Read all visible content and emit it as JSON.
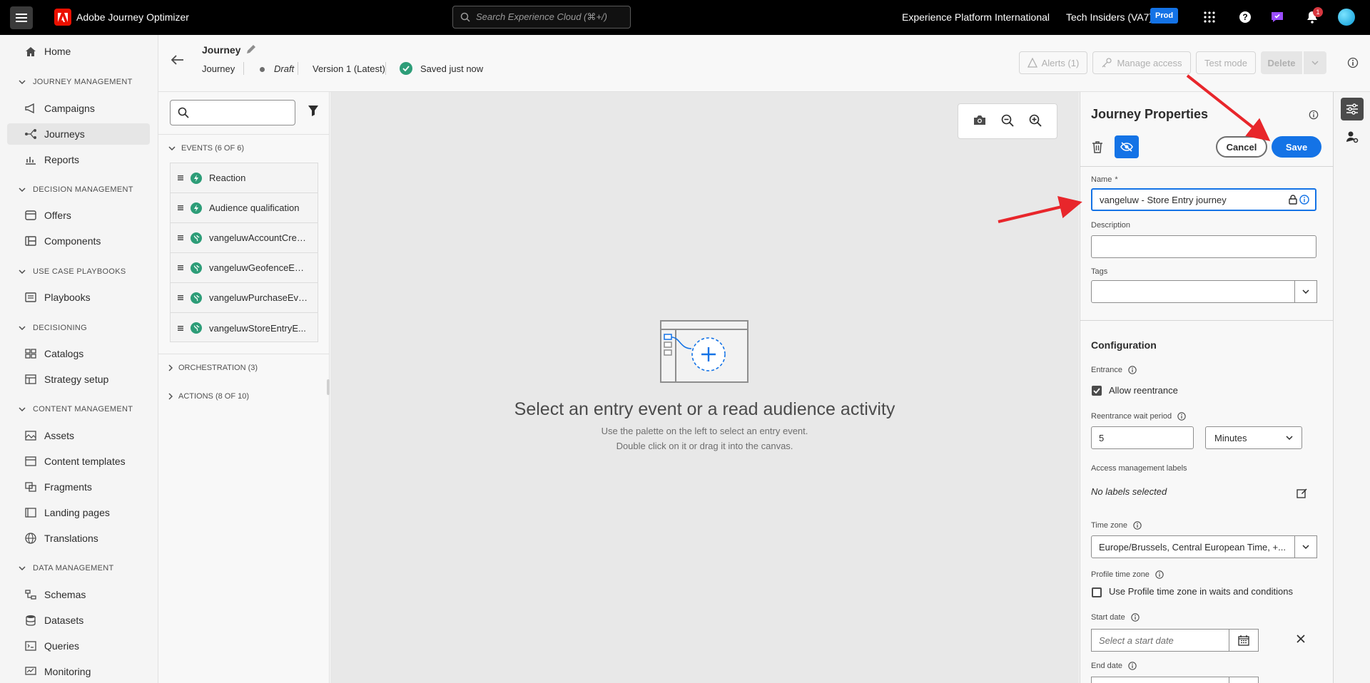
{
  "topbar": {
    "app_title": "Adobe Journey Optimizer",
    "search_placeholder": "Search Experience Cloud (⌘+/)",
    "org": "Experience Platform International",
    "sandbox": "Tech Insiders (VA7)",
    "env_badge": "Prod",
    "notification_count": "1"
  },
  "nav": {
    "home": "Home",
    "sections": {
      "journey_management": "JOURNEY MANAGEMENT",
      "decision_management": "DECISION MANAGEMENT",
      "use_case_playbooks": "USE CASE PLAYBOOKS",
      "decisioning": "DECISIONING",
      "content_management": "CONTENT MANAGEMENT",
      "data_management": "DATA MANAGEMENT"
    },
    "items": {
      "campaigns": "Campaigns",
      "journeys": "Journeys",
      "reports": "Reports",
      "offers": "Offers",
      "components": "Components",
      "playbooks": "Playbooks",
      "catalogs": "Catalogs",
      "strategy_setup": "Strategy setup",
      "assets": "Assets",
      "content_templates": "Content templates",
      "fragments": "Fragments",
      "landing_pages": "Landing pages",
      "translations": "Translations",
      "schemas": "Schemas",
      "datasets": "Datasets",
      "queries": "Queries",
      "monitoring": "Monitoring"
    }
  },
  "header": {
    "journey_name": "Journey",
    "journey_type": "Journey",
    "status": "Draft",
    "version": "Version 1 (Latest)",
    "saved": "Saved just now",
    "alerts": "Alerts (1)",
    "manage_access": "Manage access",
    "test_mode": "Test mode",
    "delete": "Delete"
  },
  "palette": {
    "events_header": "EVENTS (6 OF 6)",
    "events": [
      {
        "label": "Reaction",
        "icon": "lightning-icon"
      },
      {
        "label": "Audience qualification",
        "icon": "lightning-icon"
      },
      {
        "label": "vangeluwAccountCrea...",
        "icon": "globe-icon"
      },
      {
        "label": "vangeluwGeofenceEnt...",
        "icon": "globe-icon"
      },
      {
        "label": "vangeluwPurchaseEvent",
        "icon": "globe-icon"
      },
      {
        "label": "vangeluwStoreEntryE...",
        "icon": "globe-icon"
      }
    ],
    "orchestration_header": "ORCHESTRATION (3)",
    "actions_header": "ACTIONS (8 OF 10)"
  },
  "canvas": {
    "title": "Select an entry event or a read audience activity",
    "sub1": "Use the palette on the left to select an entry event.",
    "sub2": "Double click on it or drag it into the canvas."
  },
  "properties": {
    "title": "Journey Properties",
    "cancel": "Cancel",
    "save": "Save",
    "name_label": "Name",
    "name_required": "*",
    "name_value": "vangeluw - Store Entry journey",
    "description_label": "Description",
    "tags_label": "Tags",
    "configuration": "Configuration",
    "entrance_label": "Entrance",
    "allow_reentrance": "Allow reentrance",
    "reentrance_wait_label": "Reentrance wait period",
    "wait_value": "5",
    "wait_unit": "Minutes",
    "access_labels": "Access management labels",
    "no_labels": "No labels selected",
    "timezone_label": "Time zone",
    "timezone_value": "Europe/Brussels, Central European Time, +...",
    "profile_tz_label": "Profile time zone",
    "profile_tz_checkbox": "Use Profile time zone in waits and conditions",
    "start_date_label": "Start date",
    "start_date_placeholder": "Select a start date",
    "end_date_label": "End date"
  },
  "colors": {
    "accent": "#1473e6",
    "success": "#2d9d78",
    "annotation": "#e8262b",
    "brand": "#eb1000"
  }
}
